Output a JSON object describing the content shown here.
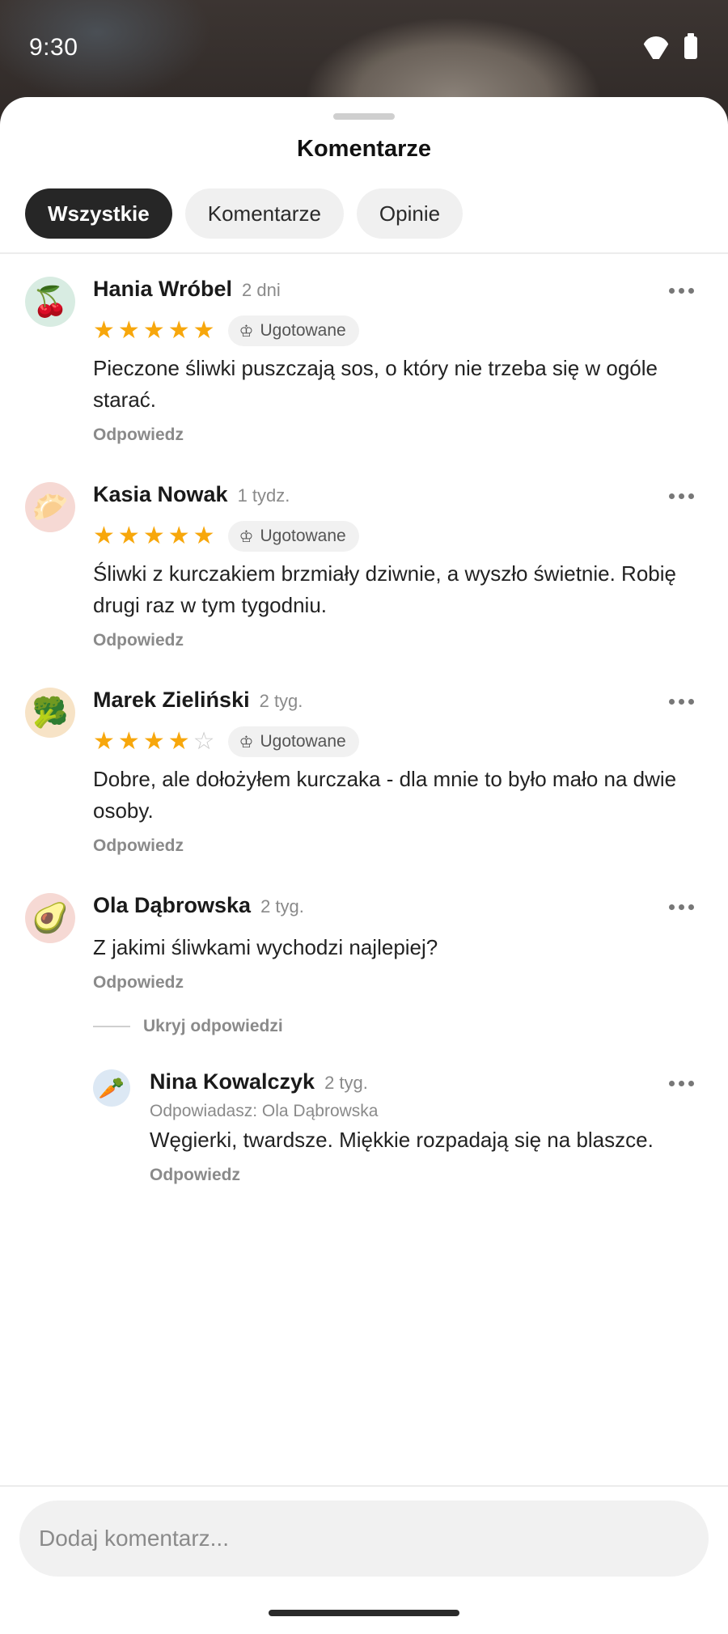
{
  "status": {
    "time": "9:30"
  },
  "sheet": {
    "title": "Komentarze",
    "tabs": [
      "Wszystkie",
      "Komentarze",
      "Opinie"
    ],
    "active_tab": "Wszystkie"
  },
  "comments": [
    {
      "name": "Hania Wróbel",
      "time": "2 dni",
      "avatar_emoji": "🍒",
      "rating": 5,
      "badge": "Ugotowane",
      "text": "Pieczone śliwki puszczają sos, o który nie trzeba się w ogóle starać.",
      "reply": "Odpowiedz"
    },
    {
      "name": "Kasia Nowak",
      "time": "1 tydz.",
      "avatar_emoji": "🥟",
      "rating": 5,
      "badge": "Ugotowane",
      "text": "Śliwki z kurczakiem brzmiały dziwnie, a wyszło świetnie. Robię drugi raz w tym tygodniu.",
      "reply": "Odpowiedz"
    },
    {
      "name": "Marek Zieliński",
      "time": "2 tyg.",
      "avatar_emoji": "🥦",
      "rating": 4,
      "badge": "Ugotowane",
      "text": "Dobre, ale dołożyłem kurczaka - dla mnie to było mało na dwie osoby.",
      "reply": "Odpowiedz"
    },
    {
      "name": "Ola Dąbrowska",
      "time": "2 tyg.",
      "avatar_emoji": "🥑",
      "text": "Z jakimi śliwkami wychodzi najlepiej?",
      "reply": "Odpowiedz",
      "hide_replies": "Ukryj odpowiedzi"
    }
  ],
  "subcomment": {
    "name": "Nina Kowalczyk",
    "time": "2 tyg.",
    "avatar_emoji": "🥕",
    "replying_to": "Odpowiadasz: Ola Dąbrowska",
    "text": "Węgierki, twardsze. Miękkie rozpadają się na blaszce.",
    "reply": "Odpowiedz"
  },
  "input": {
    "placeholder": "Dodaj komentarz..."
  },
  "colors": {
    "star": "#f7a70c",
    "active_tab_bg": "#262626"
  }
}
